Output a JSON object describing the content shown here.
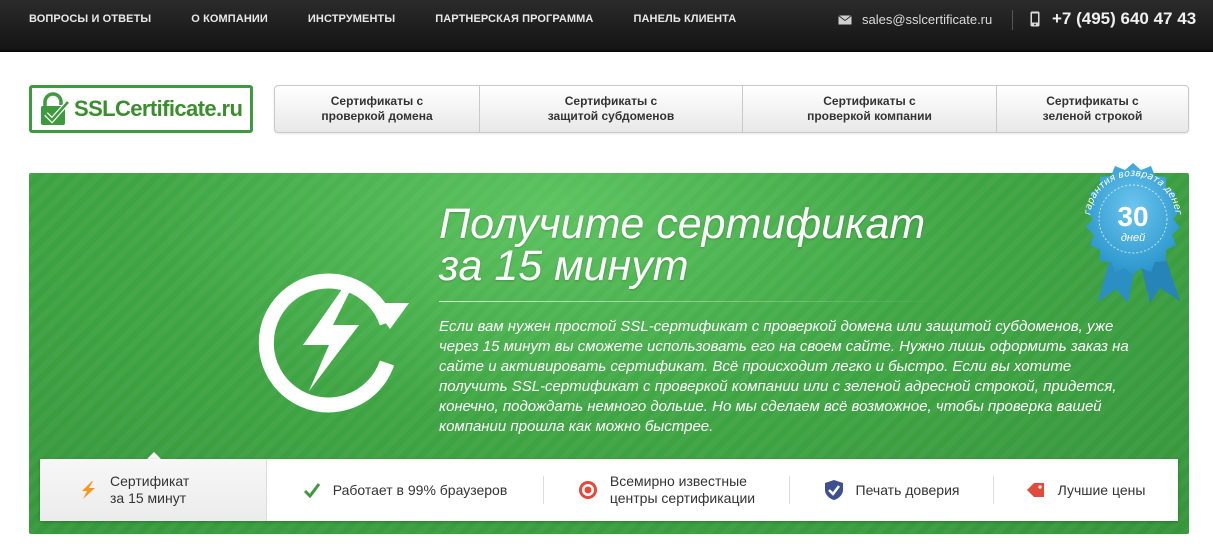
{
  "topnav": {
    "items": [
      {
        "label": "ВОПРОСЫ И ОТВЕТЫ"
      },
      {
        "label": "О КОМПАНИИ"
      },
      {
        "label": "ИНСТРУМЕНТЫ"
      },
      {
        "label": "ПАРТНЕРСКАЯ ПРОГРАММА"
      },
      {
        "label": "ПАНЕЛЬ КЛИЕНТА"
      }
    ],
    "email": "sales@sslcertificate.ru",
    "phone": "+7 (495) 640 47 43"
  },
  "logo": {
    "text": "SSLCertificate.ru"
  },
  "categories": [
    {
      "line1": "Сертификаты с",
      "line2": "проверкой домена"
    },
    {
      "line1": "Сертификаты с",
      "line2": "защитой субдоменов"
    },
    {
      "line1": "Сертификаты с",
      "line2": "проверкой компании"
    },
    {
      "line1": "Сертификаты с",
      "line2": "зеленой строкой"
    }
  ],
  "hero": {
    "title_line1": "Получите сертификат",
    "title_line2": "за 15 минут",
    "text": "Если вам нужен простой SSL-сертификат с проверкой домена или защитой субдоменов, уже через 15 минут вы сможете использовать его на своем сайте. Нужно лишь оформить заказ на сайте и активировать сертификат. Всё происходит легко и быстро. Если вы хотите получить SSL-сертификат с проверкой компании или с зеленой адресной строкой, придется, конечно, подождать немного дольше. Но мы сделаем всё возможное, чтобы проверка вашей компании прошла как можно быстрее."
  },
  "badge": {
    "arc_text": "гарантия возврата денег",
    "number": "30",
    "unit": "дней"
  },
  "features": [
    {
      "line1": "Сертификат",
      "line2": "за 15 минут",
      "icon": "lightning-icon"
    },
    {
      "line1": "Работает в 99% браузеров",
      "line2": "",
      "icon": "checkmark-icon"
    },
    {
      "line1": "Всемирно известные",
      "line2": "центры сертификации",
      "icon": "target-icon"
    },
    {
      "line1": "Печать доверия",
      "line2": "",
      "icon": "shield-icon"
    },
    {
      "line1": "Лучшие цены",
      "line2": "",
      "icon": "price-tag-icon"
    }
  ],
  "colors": {
    "green": "#3fa544",
    "logo_green": "#3e9a3e",
    "dark_bar": "#1c1c1c",
    "badge_blue": "#3aa6d9"
  }
}
